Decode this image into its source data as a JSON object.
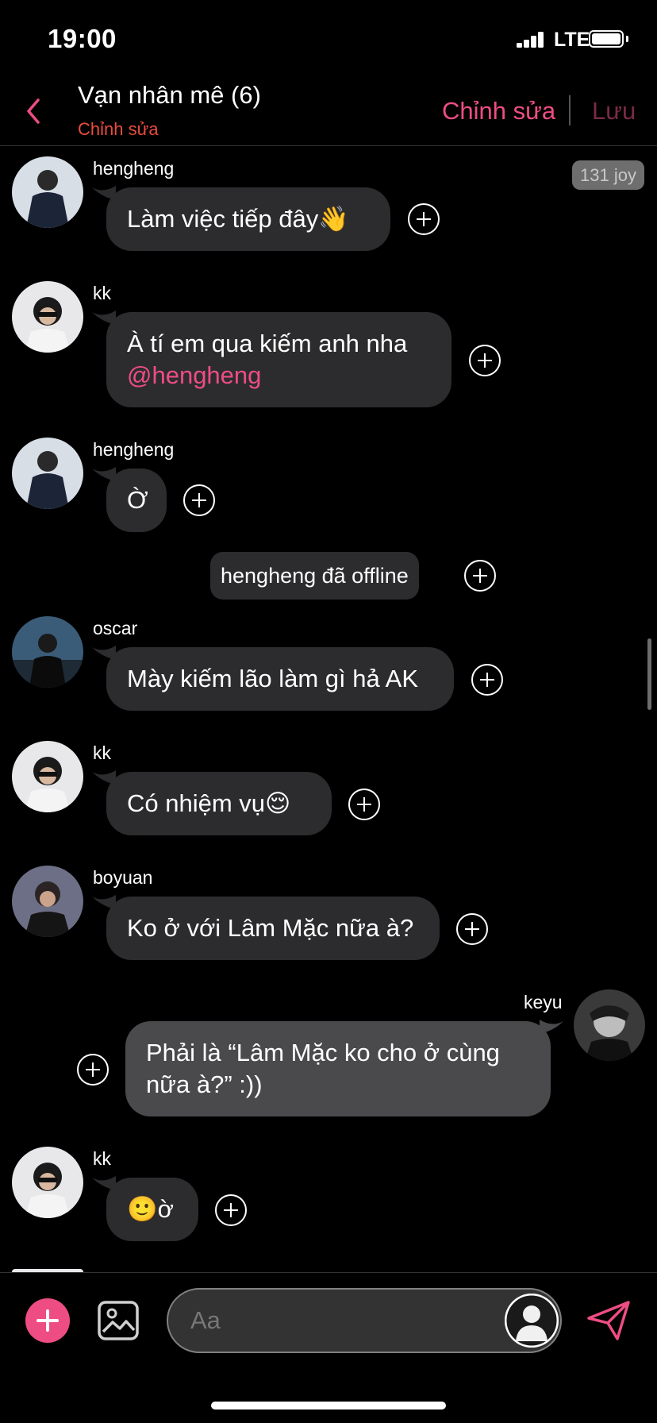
{
  "status_bar": {
    "time": "19:00",
    "network": "LTE"
  },
  "header": {
    "title": "Vạn nhân mê (6)",
    "subtitle": "Chỉnh sửa",
    "edit_label": "Chỉnh sửa",
    "save_label": "Lưu"
  },
  "badge": {
    "joy": "131 joy"
  },
  "messages": [
    {
      "sender": "hengheng",
      "text": "Làm việc tiếp đây👋"
    },
    {
      "sender": "kk",
      "text_line1": "À tí em qua kiếm anh nha",
      "mention": "@hengheng"
    },
    {
      "sender": "hengheng",
      "text": "Ờ"
    },
    {
      "system": "hengheng đã offline"
    },
    {
      "sender": "oscar",
      "text": "Mày kiếm lão làm gì hả AK"
    },
    {
      "sender": "kk",
      "text": "Có nhiệm vụ😌"
    },
    {
      "sender": "boyuan",
      "text": "Ko ở với Lâm Mặc nữa à?"
    },
    {
      "sender": "keyu",
      "text_line1": "Phải là “Lâm Mặc ko cho ở cùng",
      "text_line2": "nữa à?” :))"
    },
    {
      "sender": "kk",
      "text": "🙂ờ"
    }
  ],
  "composer": {
    "placeholder": "Aa"
  },
  "colors": {
    "accent": "#ee4d83",
    "bubble_in": "#2c2c2e",
    "bubble_out": "#4a4a4c",
    "subtitle_red": "#e84c3d"
  }
}
